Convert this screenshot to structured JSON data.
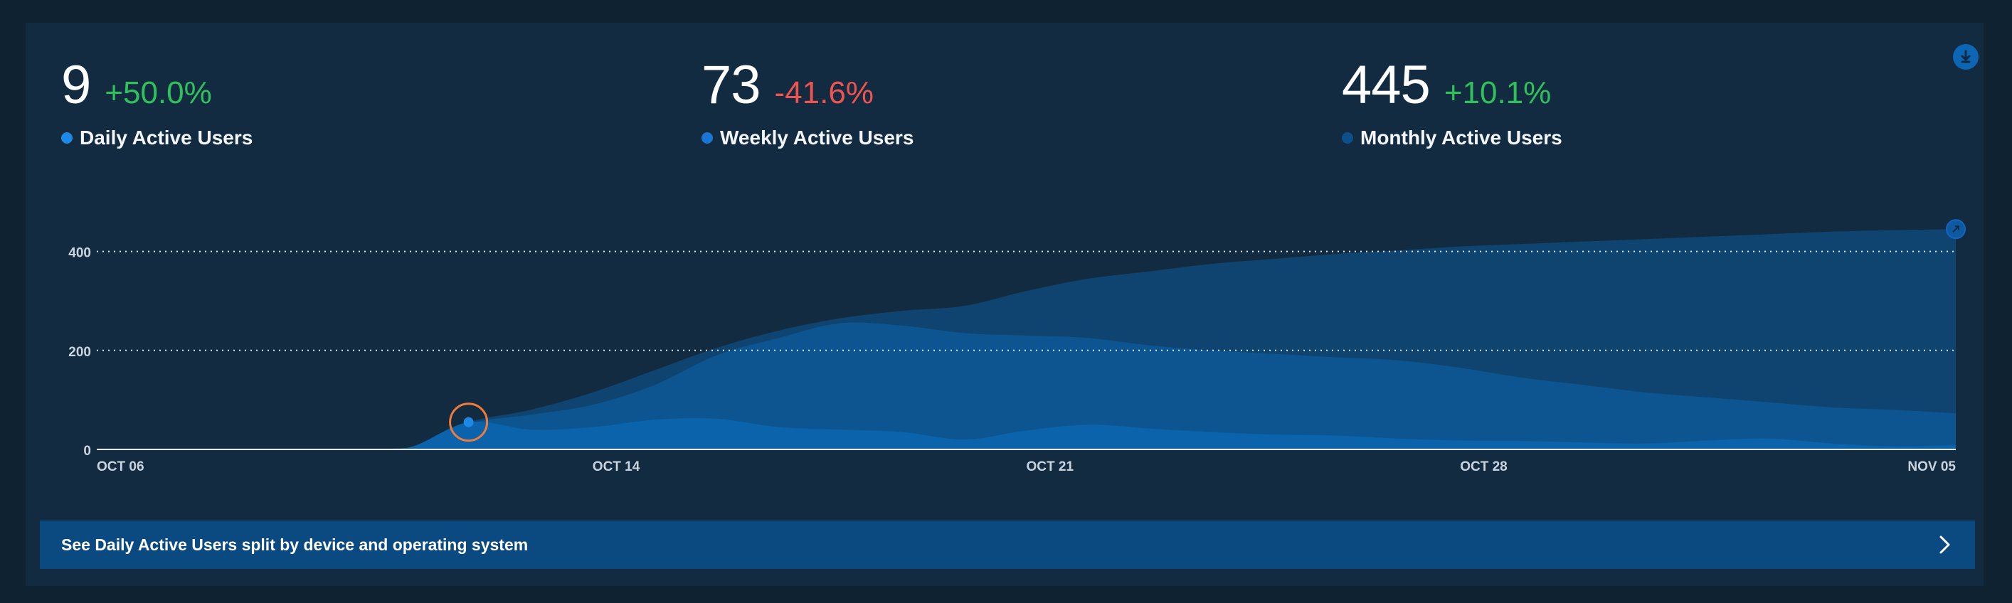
{
  "metrics": [
    {
      "value": "9",
      "change": "+50.0%",
      "direction": "up",
      "label": "Daily Active Users",
      "dot_color": "#1e88e5"
    },
    {
      "value": "73",
      "change": "-41.6%",
      "direction": "down",
      "label": "Weekly Active Users",
      "dot_color": "#1976d2"
    },
    {
      "value": "445",
      "change": "+10.1%",
      "direction": "up",
      "label": "Monthly Active Users",
      "dot_color": "#0d4f8b"
    }
  ],
  "colors": {
    "background": "#122b40",
    "positive": "#2fc25b",
    "negative": "#ef5350",
    "mau_fill": "#0f4470",
    "wau_fill": "#0d5590",
    "dau_fill": "#0a63ab",
    "highlight": "#f07c3c"
  },
  "icons": {
    "download": "download-circle-icon",
    "banner": "chevron-right-icon"
  },
  "banner": {
    "text": "See Daily Active Users split by device and operating system"
  },
  "chart_data": {
    "type": "area",
    "stacked": false,
    "x": [
      "Oct 06",
      "Oct 07",
      "Oct 08",
      "Oct 09",
      "Oct 10",
      "Oct 11",
      "Oct 12",
      "Oct 13",
      "Oct 14",
      "Oct 15",
      "Oct 16",
      "Oct 17",
      "Oct 18",
      "Oct 19",
      "Oct 20",
      "Oct 21",
      "Oct 22",
      "Oct 23",
      "Oct 24",
      "Oct 25",
      "Oct 26",
      "Oct 27",
      "Oct 28",
      "Oct 29",
      "Oct 30",
      "Oct 31",
      "Nov 01",
      "Nov 02",
      "Nov 03",
      "Nov 04",
      "Nov 05"
    ],
    "x_tick_labels": [
      {
        "index": 0,
        "label": "OCT 06"
      },
      {
        "index": 8,
        "label": "OCT 14"
      },
      {
        "index": 15,
        "label": "OCT 21"
      },
      {
        "index": 22,
        "label": "OCT 28"
      },
      {
        "index": 30,
        "label": "NOV 05"
      }
    ],
    "y_ticks": [
      0,
      200,
      400
    ],
    "ylim": [
      0,
      480
    ],
    "grid": "dotted horizontal",
    "series": [
      {
        "name": "Monthly Active Users",
        "values": [
          0,
          0,
          0,
          0,
          0,
          3,
          55,
          80,
          115,
          160,
          205,
          240,
          265,
          280,
          290,
          320,
          345,
          360,
          375,
          385,
          395,
          402,
          410,
          415,
          420,
          425,
          430,
          435,
          440,
          443,
          445
        ]
      },
      {
        "name": "Weekly Active Users",
        "values": [
          0,
          0,
          0,
          0,
          0,
          3,
          52,
          70,
          90,
          130,
          190,
          225,
          255,
          250,
          235,
          230,
          225,
          210,
          200,
          193,
          186,
          180,
          165,
          145,
          130,
          115,
          105,
          95,
          85,
          80,
          73
        ]
      },
      {
        "name": "Daily Active Users",
        "values": [
          0,
          0,
          0,
          0,
          0,
          2,
          55,
          40,
          45,
          60,
          62,
          45,
          40,
          35,
          20,
          38,
          50,
          42,
          35,
          30,
          28,
          22,
          18,
          17,
          14,
          12,
          18,
          22,
          12,
          6,
          9
        ]
      }
    ],
    "highlight": {
      "index": 6
    }
  }
}
